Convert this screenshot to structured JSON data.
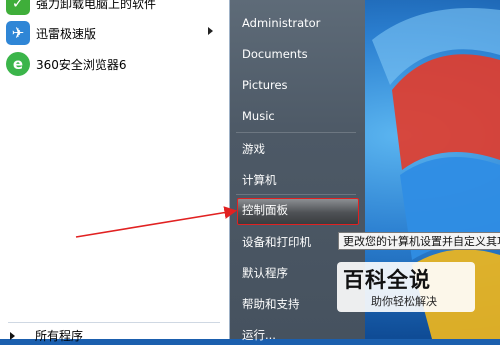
{
  "start_menu": {
    "programs": [
      {
        "label": "强力卸载电脑上的软件",
        "icon": "uninstall-icon",
        "color": "#3fae3a"
      },
      {
        "label": "迅雷极速版",
        "icon": "thunder-bird-icon",
        "color": "#2f86d6",
        "has_submenu": true
      },
      {
        "label": "360安全浏览器6",
        "icon": "browser-360-icon",
        "color": "#3bb54a"
      }
    ],
    "all_programs": "所有程序",
    "right_items": [
      {
        "label": "Administrator"
      },
      {
        "label": "Documents"
      },
      {
        "label": "Pictures"
      },
      {
        "label": "Music"
      },
      {
        "label": "游戏"
      },
      {
        "label": "计算机"
      },
      {
        "label": "控制面板"
      },
      {
        "label": "设备和打印机"
      },
      {
        "label": "默认程序"
      },
      {
        "label": "帮助和支持"
      },
      {
        "label": "运行..."
      }
    ]
  },
  "tooltip": "更改您的计算机设置并自定义其功能",
  "watermark": {
    "title": "百科全说",
    "subtitle": "助你轻松解决"
  },
  "colors": {
    "highlight_border": "#e12121",
    "annotation_arrow": "#e12121",
    "right_pane": "#4d5966"
  }
}
